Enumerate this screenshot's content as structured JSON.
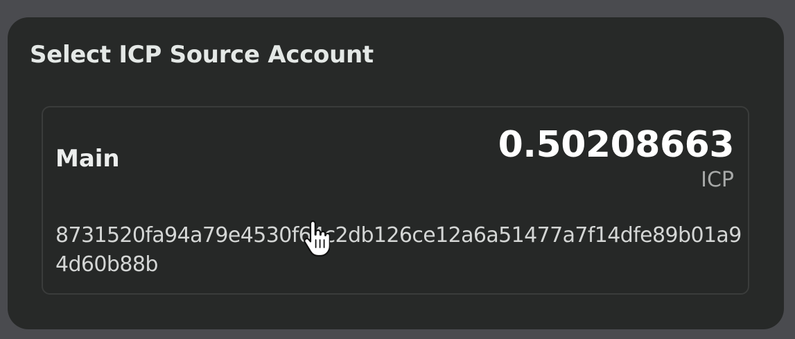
{
  "panel": {
    "title": "Select ICP Source Account"
  },
  "account": {
    "name": "Main",
    "balance": "0.50208663",
    "token": "ICP",
    "identifier": "8731520fa94a79e4530f64c2db126ce12a6a51477a7f14dfe89b01a94d60b88b"
  },
  "cursor": {
    "icon": "hand-pointer-icon"
  },
  "colors": {
    "page_background": "#4a4b4f",
    "panel_background": "#272928",
    "card_border": "#3a3c3b",
    "text_primary": "#ffffff",
    "text_muted": "#a7a9a8"
  }
}
